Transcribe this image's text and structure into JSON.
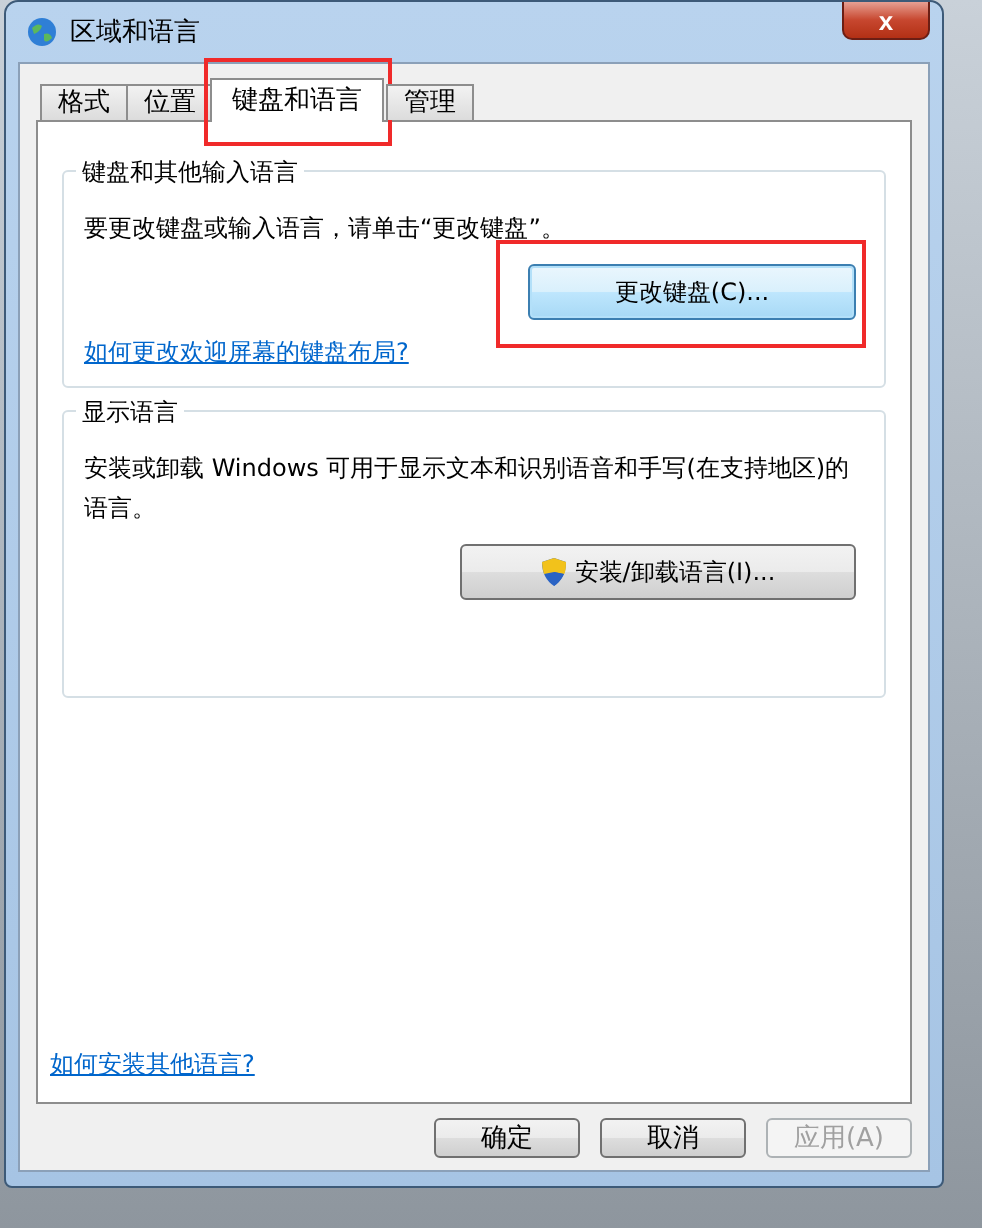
{
  "window": {
    "title": "区域和语言",
    "close": "x"
  },
  "tabs": [
    {
      "label": "格式",
      "selected": false,
      "highlighted": false
    },
    {
      "label": "位置",
      "selected": false,
      "highlighted": false
    },
    {
      "label": "键盘和语言",
      "selected": true,
      "highlighted": true
    },
    {
      "label": "管理",
      "selected": false,
      "highlighted": false
    }
  ],
  "groups": [
    {
      "title": "键盘和其他输入语言",
      "text": "要更改键盘或输入语言，请单击“更改键盘”。",
      "button": {
        "label": "更改键盘(C)...",
        "shield": false,
        "highlighted": true,
        "focused": true
      },
      "link": "如何更改欢迎屏幕的键盘布局?"
    },
    {
      "title": "显示语言",
      "text": "安装或卸载 Windows 可用于显示文本和识别语音和手写(在支持地区)的语言。",
      "button": {
        "label": "安装/卸载语言(I)...",
        "shield": true,
        "highlighted": false,
        "focused": false
      }
    }
  ],
  "footer_link": "如何安装其他语言?",
  "buttons": [
    {
      "label": "确定",
      "disabled": false
    },
    {
      "label": "取消",
      "disabled": false
    },
    {
      "label": "应用(A)",
      "disabled": true
    }
  ]
}
